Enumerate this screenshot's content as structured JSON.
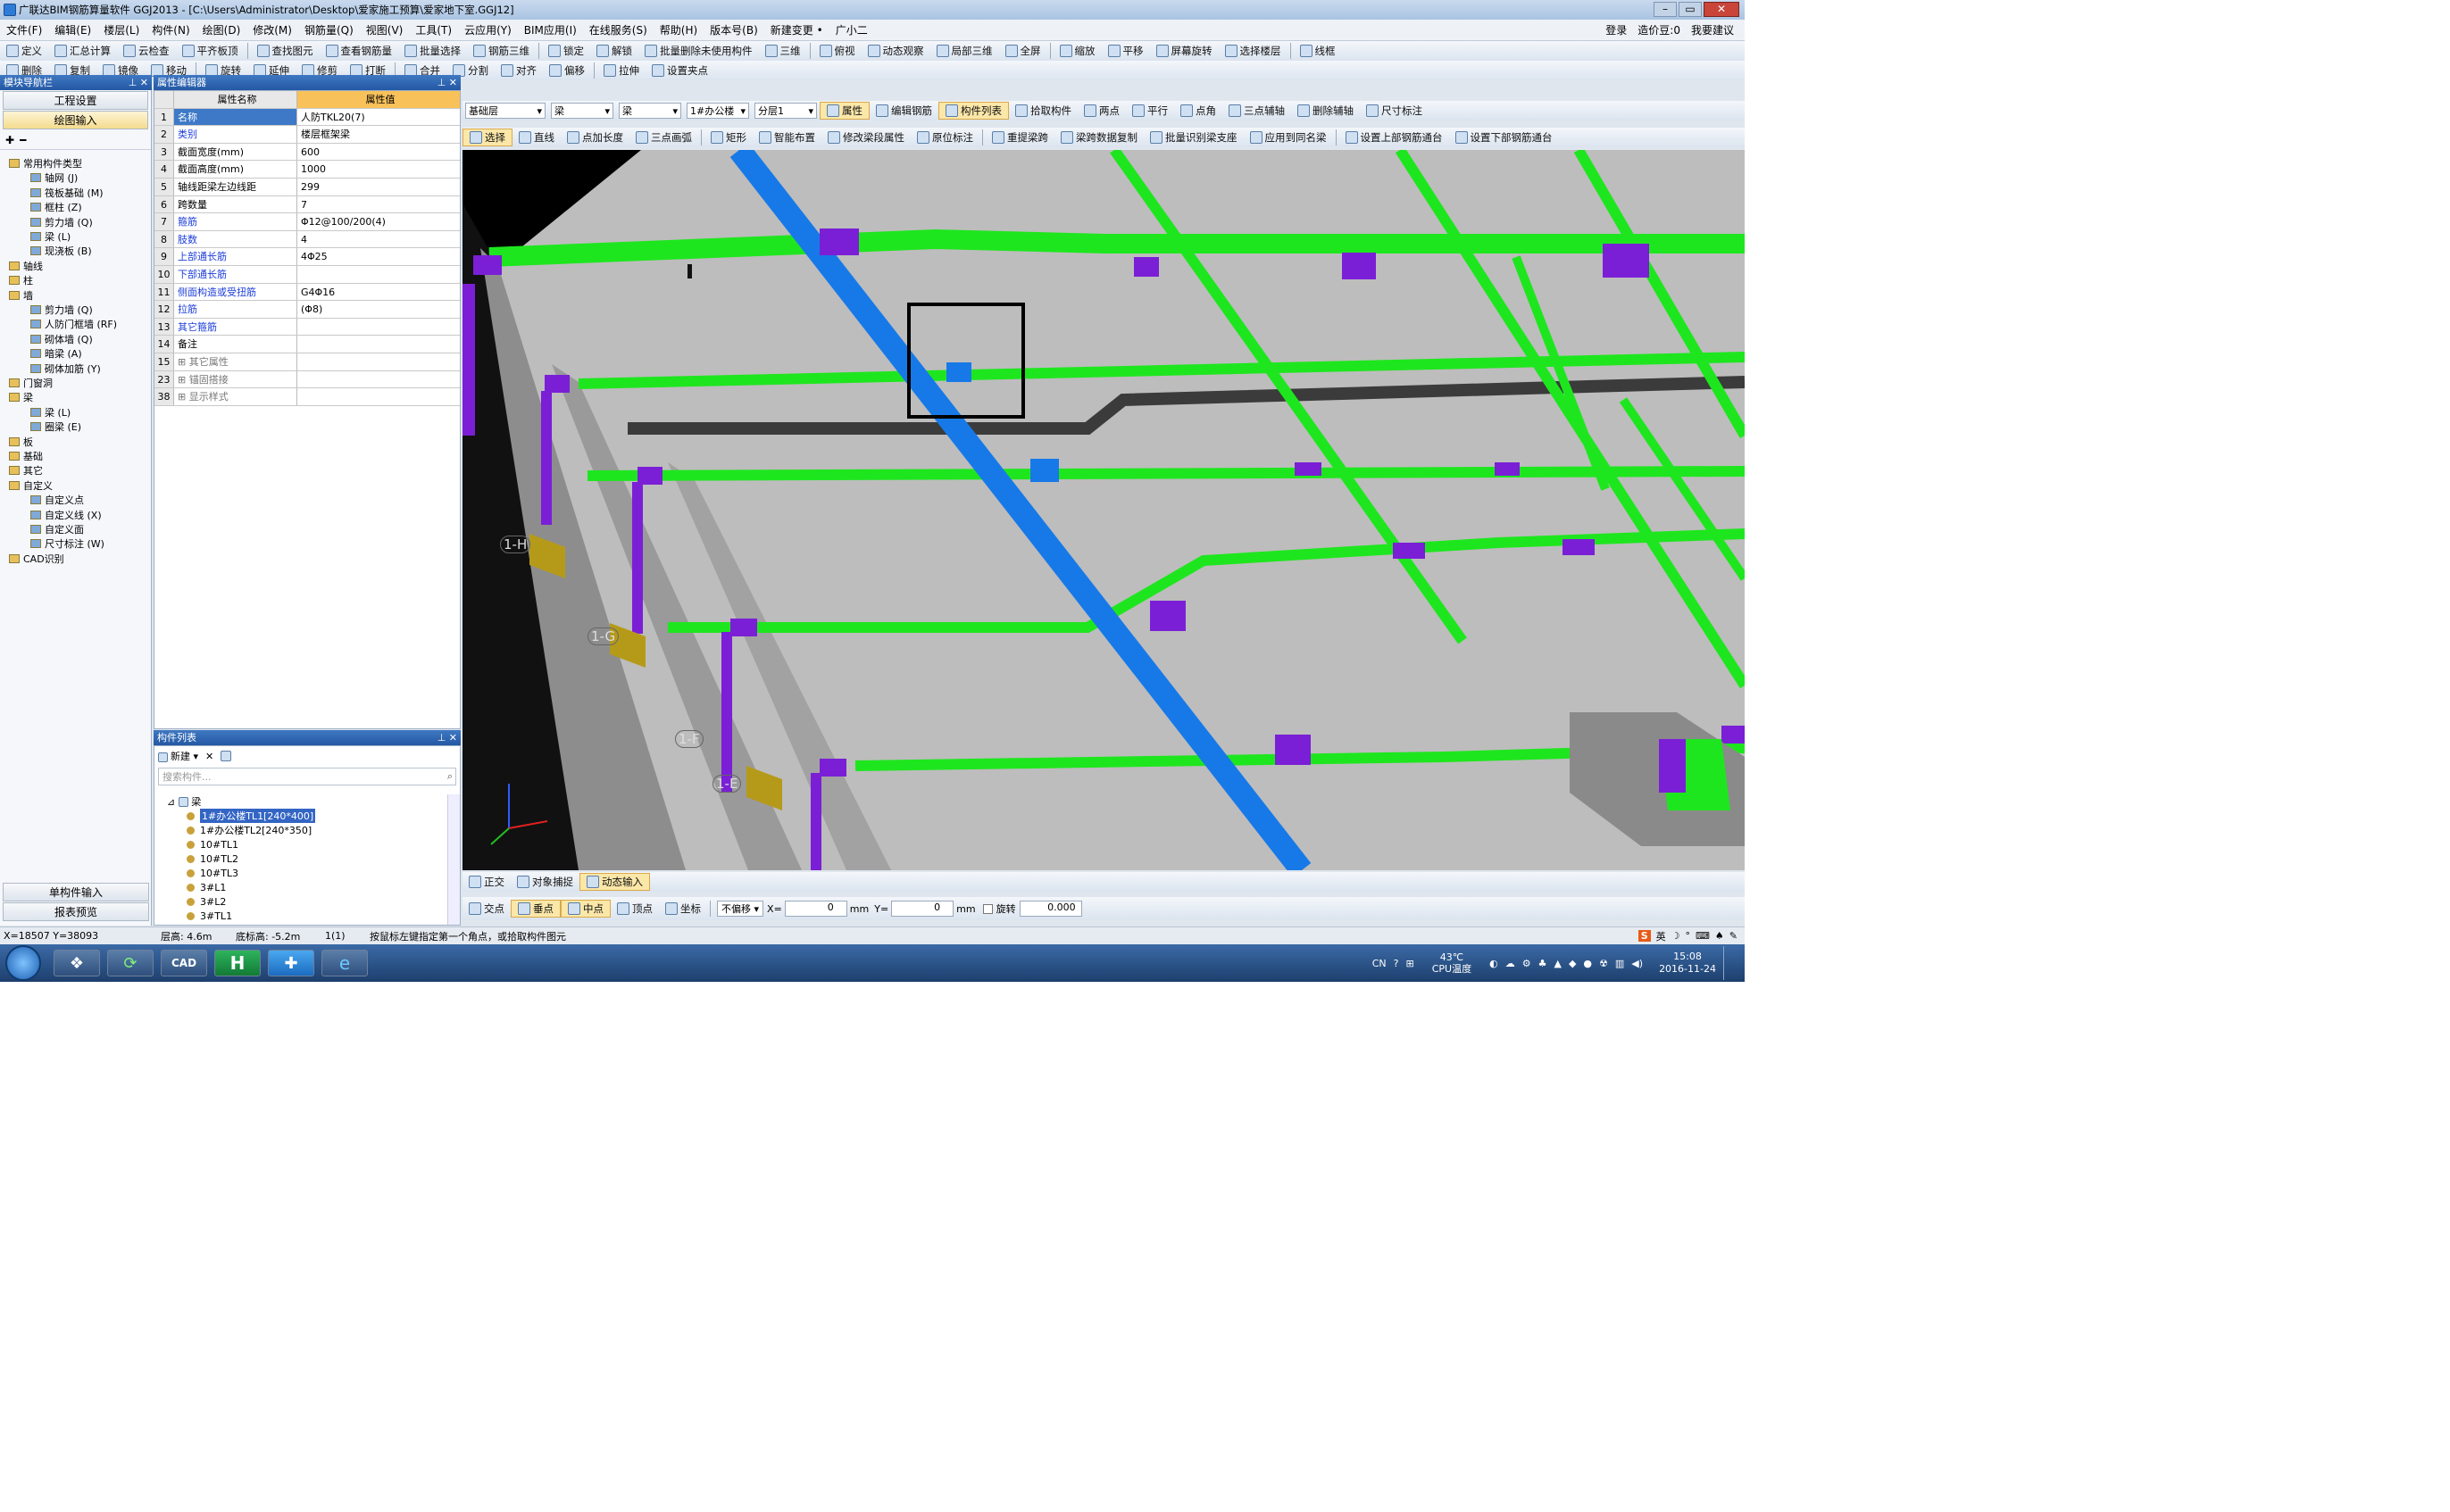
{
  "title": "广联达BIM钢筋算量软件 GGJ2013 - [C:\\Users\\Administrator\\Desktop\\爱家施工预算\\爱家地下室.GGJ12]",
  "menu": [
    "文件(F)",
    "编辑(E)",
    "楼层(L)",
    "构件(N)",
    "绘图(D)",
    "修改(M)",
    "钢筋量(Q)",
    "视图(V)",
    "工具(T)",
    "云应用(Y)",
    "BIM应用(I)",
    "在线服务(S)",
    "帮助(H)",
    "版本号(B)",
    "新建变更 •",
    "广小二"
  ],
  "menu_right": {
    "login": "登录",
    "beans": "造价豆:0",
    "suggest": "我要建议"
  },
  "toolbar1": [
    "定义",
    "汇总计算",
    "云检查",
    "平齐板顶",
    "查找图元",
    "查看钢筋量",
    "批量选择",
    "钢筋三维",
    "锁定",
    "解锁",
    "批量删除未使用构件",
    "三维",
    "俯视",
    "动态观察",
    "局部三维",
    "全屏",
    "缩放",
    "平移",
    "屏幕旋转",
    "选择楼层",
    "线框"
  ],
  "toolbar2": [
    "删除",
    "复制",
    "镜像",
    "移动",
    "旋转",
    "延伸",
    "修剪",
    "打断",
    "合并",
    "分割",
    "对齐",
    "偏移",
    "拉伸",
    "设置夹点"
  ],
  "toolbar3": {
    "floor": "基础层",
    "type1": "梁",
    "type2": "梁",
    "member": "1#办公楼",
    "layer": "分层1",
    "items": [
      "属性",
      "编辑钢筋",
      "构件列表",
      "拾取构件",
      "两点",
      "平行",
      "点角",
      "三点辅轴",
      "删除辅轴",
      "尺寸标注"
    ]
  },
  "toolbar4": [
    "选择",
    "直线",
    "点加长度",
    "三点画弧",
    "矩形",
    "智能布置",
    "修改梁段属性",
    "原位标注",
    "重提梁跨",
    "梁跨数据复制",
    "批量识别梁支座",
    "应用到同名梁",
    "设置上部钢筋通台",
    "设置下部钢筋通台"
  ],
  "nav": {
    "title": "模块导航栏",
    "btn_project": "工程设置",
    "btn_draw": "绘图输入",
    "btn_single": "单构件输入",
    "btn_report": "报表预览"
  },
  "tree": [
    {
      "label": "常用构件类型",
      "level": 0
    },
    {
      "label": "轴网 (J)",
      "level": 1
    },
    {
      "label": "筏板基础 (M)",
      "level": 1
    },
    {
      "label": "框柱 (Z)",
      "level": 1
    },
    {
      "label": "剪力墙 (Q)",
      "level": 1
    },
    {
      "label": "梁 (L)",
      "level": 1
    },
    {
      "label": "现浇板 (B)",
      "level": 1
    },
    {
      "label": "轴线",
      "level": 0
    },
    {
      "label": "柱",
      "level": 0
    },
    {
      "label": "墙",
      "level": 0
    },
    {
      "label": "剪力墙 (Q)",
      "level": 1
    },
    {
      "label": "人防门框墙 (RF)",
      "level": 1
    },
    {
      "label": "砌体墙 (Q)",
      "level": 1
    },
    {
      "label": "暗梁 (A)",
      "level": 1
    },
    {
      "label": "砌体加筋 (Y)",
      "level": 1
    },
    {
      "label": "门窗洞",
      "level": 0
    },
    {
      "label": "梁",
      "level": 0
    },
    {
      "label": "梁 (L)",
      "level": 1
    },
    {
      "label": "圈梁 (E)",
      "level": 1
    },
    {
      "label": "板",
      "level": 0
    },
    {
      "label": "基础",
      "level": 0
    },
    {
      "label": "其它",
      "level": 0
    },
    {
      "label": "自定义",
      "level": 0
    },
    {
      "label": "自定义点",
      "level": 1
    },
    {
      "label": "自定义线 (X)",
      "level": 1
    },
    {
      "label": "自定义面",
      "level": 1
    },
    {
      "label": "尺寸标注 (W)",
      "level": 1
    },
    {
      "label": "CAD识别",
      "level": 0
    }
  ],
  "props": {
    "title": "属性编辑器",
    "col_name": "属性名称",
    "col_value": "属性值",
    "rows": [
      {
        "n": "1",
        "k": "名称",
        "v": "人防TKL20(7)",
        "blue": false
      },
      {
        "n": "2",
        "k": "类别",
        "v": "楼层框架梁",
        "blue": true
      },
      {
        "n": "3",
        "k": "截面宽度(mm)",
        "v": "600",
        "blue": false
      },
      {
        "n": "4",
        "k": "截面高度(mm)",
        "v": "1000",
        "blue": false
      },
      {
        "n": "5",
        "k": "轴线距梁左边线距",
        "v": "299",
        "blue": false
      },
      {
        "n": "6",
        "k": "跨数量",
        "v": "7",
        "blue": false
      },
      {
        "n": "7",
        "k": "箍筋",
        "v": "Φ12@100/200(4)",
        "blue": true
      },
      {
        "n": "8",
        "k": "肢数",
        "v": "4",
        "blue": true
      },
      {
        "n": "9",
        "k": "上部通长筋",
        "v": "4Φ25",
        "blue": true
      },
      {
        "n": "10",
        "k": "下部通长筋",
        "v": "",
        "blue": true
      },
      {
        "n": "11",
        "k": "侧面构造或受扭筋",
        "v": "G4Φ16",
        "blue": true
      },
      {
        "n": "12",
        "k": "拉筋",
        "v": "(Φ8)",
        "blue": true
      },
      {
        "n": "13",
        "k": "其它箍筋",
        "v": "",
        "blue": true
      },
      {
        "n": "14",
        "k": "备注",
        "v": "",
        "blue": false
      },
      {
        "n": "15",
        "k": "其它属性",
        "v": "",
        "blue": false,
        "gray": true
      },
      {
        "n": "23",
        "k": "锚固搭接",
        "v": "",
        "blue": false,
        "gray": true
      },
      {
        "n": "38",
        "k": "显示样式",
        "v": "",
        "blue": false,
        "gray": true
      }
    ]
  },
  "members": {
    "title": "构件列表",
    "new": "新建",
    "search_placeholder": "搜索构件...",
    "root": "梁",
    "items": [
      "1#办公楼TL1[240*400]",
      "1#办公楼TL2[240*350]",
      "10#TL1",
      "10#TL2",
      "10#TL3",
      "3#L1",
      "3#L2",
      "3#TL1"
    ]
  },
  "viewport": {
    "axes": [
      "1-H",
      "1-G",
      "1-F",
      "1-E"
    ]
  },
  "snapbar": {
    "items": [
      "正交",
      "对象捕捉",
      "动态输入"
    ]
  },
  "snapbar2": {
    "items": [
      "交点",
      "垂点",
      "中点",
      "顶点",
      "坐标"
    ],
    "offset": "不偏移",
    "x_label": "X=",
    "x_val": "0",
    "y_label": "Y=",
    "y_val": "0",
    "unit": "mm",
    "rotate": "旋转",
    "rotate_val": "0.000"
  },
  "status": {
    "coords": "X=18507  Y=38093",
    "floor_h": "层高: 4.6m",
    "base_h": "底标高: -5.2m",
    "count": "1(1)",
    "hint": "按鼠标左键指定第一个角点，或拾取构件图元"
  },
  "taskbar": {
    "ime": "CN",
    "temp": "43℃",
    "temp_label": "CPU温度",
    "time": "15:08",
    "date": "2016-11-24",
    "cad_label": "CAD"
  },
  "colors": {
    "beam_green": "#1ee61e",
    "beam_blue": "#1779e8",
    "column_purple": "#7a1fd6",
    "slab": "#b9b9b9",
    "dark_beam": "#3b3b3b"
  }
}
